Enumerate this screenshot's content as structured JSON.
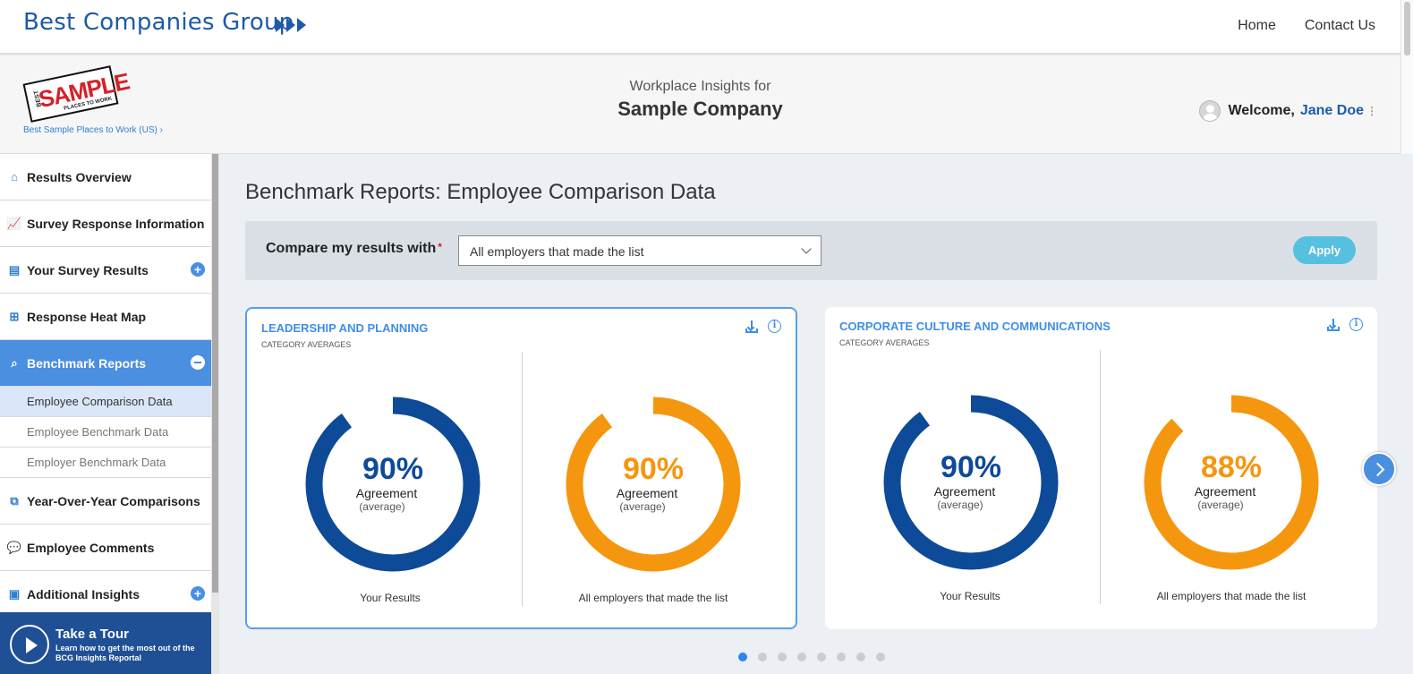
{
  "nav": {
    "brand": "Best Companies Group",
    "links": [
      "Home",
      "Contact Us"
    ]
  },
  "header": {
    "logo": {
      "best": "BEST",
      "sample": "SAMPLE",
      "places": "PLACES TO WORK"
    },
    "program_link": "Best Sample Places to Work (US)  ›",
    "subtitle": "Workplace Insights for",
    "company": "Sample Company",
    "welcome": "Welcome,",
    "user_name": "Jane Doe"
  },
  "sidebar": {
    "items": [
      {
        "label": "Results Overview",
        "icon": "home-icon"
      },
      {
        "label": "Survey Response Information",
        "icon": "chart-icon"
      },
      {
        "label": "Your Survey Results",
        "icon": "clipboard-icon"
      },
      {
        "label": "Response Heat Map",
        "icon": "heatmap-icon"
      },
      {
        "label": "Benchmark Reports",
        "icon": "magnify-chart-icon"
      },
      {
        "label": "Year-Over-Year Comparisons",
        "icon": "compare-icon"
      },
      {
        "label": "Employee Comments",
        "icon": "comments-icon"
      },
      {
        "label": "Additional Insights",
        "icon": "insights-icon"
      }
    ],
    "subitems": [
      "Employee Comparison Data",
      "Employee Benchmark Data",
      "Employer Benchmark Data"
    ],
    "tour_title": "Take a Tour",
    "tour_sub": "Learn how to get the most out of the BCG Insights Reportal"
  },
  "main": {
    "title": "Benchmark Reports: Employee Comparison Data",
    "compare_label": "Compare my results with",
    "required_mark": "*",
    "compare_value": "All employers that made the list",
    "apply_label": "Apply"
  },
  "cards": [
    {
      "title": "Leadership and Planning",
      "subtitle": "Category Averages",
      "left": {
        "pct_text": "90%",
        "value": 90,
        "label": "Agreement",
        "sub": "(average)",
        "caption": "Your Results"
      },
      "right": {
        "pct_text": "90%",
        "value": 90,
        "label": "Agreement",
        "sub": "(average)",
        "caption": "All employers that made the list"
      }
    },
    {
      "title": "Corporate Culture and Communications",
      "subtitle": "Category Averages",
      "left": {
        "pct_text": "90%",
        "value": 90,
        "label": "Agreement",
        "sub": "(average)",
        "caption": "Your Results"
      },
      "right": {
        "pct_text": "88%",
        "value": 88,
        "label": "Agreement",
        "sub": "(average)",
        "caption": "All employers that made the list"
      }
    }
  ],
  "colors": {
    "your_results": "#0d4a97",
    "comparison": "#f5960f",
    "accent": "#4a8fe0"
  },
  "pagination": {
    "total": 8,
    "current": 1
  }
}
